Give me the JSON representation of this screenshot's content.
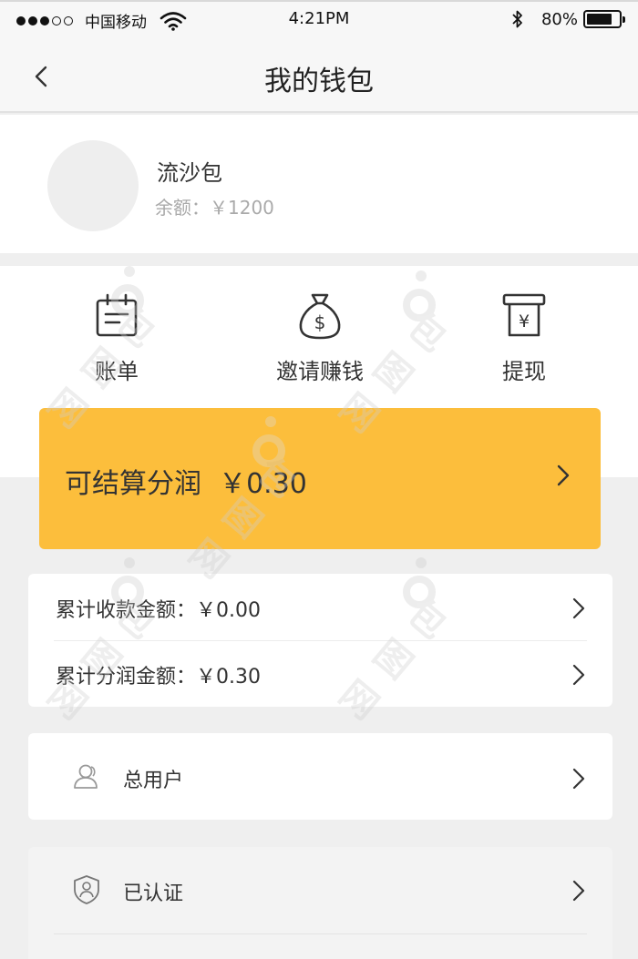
{
  "status_bar": {
    "carrier": "中国移动",
    "time": "4:21PM",
    "battery_percent": "80%",
    "battery_level": 0.8
  },
  "nav": {
    "title": "我的钱包"
  },
  "profile": {
    "name": "流沙包",
    "balance_text": "余额：￥1200"
  },
  "actions": [
    {
      "label": "账单",
      "icon": "bill-calendar-icon"
    },
    {
      "label": "邀请赚钱",
      "icon": "money-bag-icon"
    },
    {
      "label": "提现",
      "icon": "withdraw-atm-icon"
    }
  ],
  "profit": {
    "text": "可结算分润  ￥0.30"
  },
  "totals": {
    "received": "累计收款金额：￥0.00",
    "shared": "累计分润金额：￥0.30"
  },
  "menu": {
    "users": "总用户",
    "verified": "已认证"
  },
  "watermark": "包图网",
  "colors": {
    "accent": "#fcbe3c",
    "background": "#efefef",
    "card": "#ffffff"
  }
}
